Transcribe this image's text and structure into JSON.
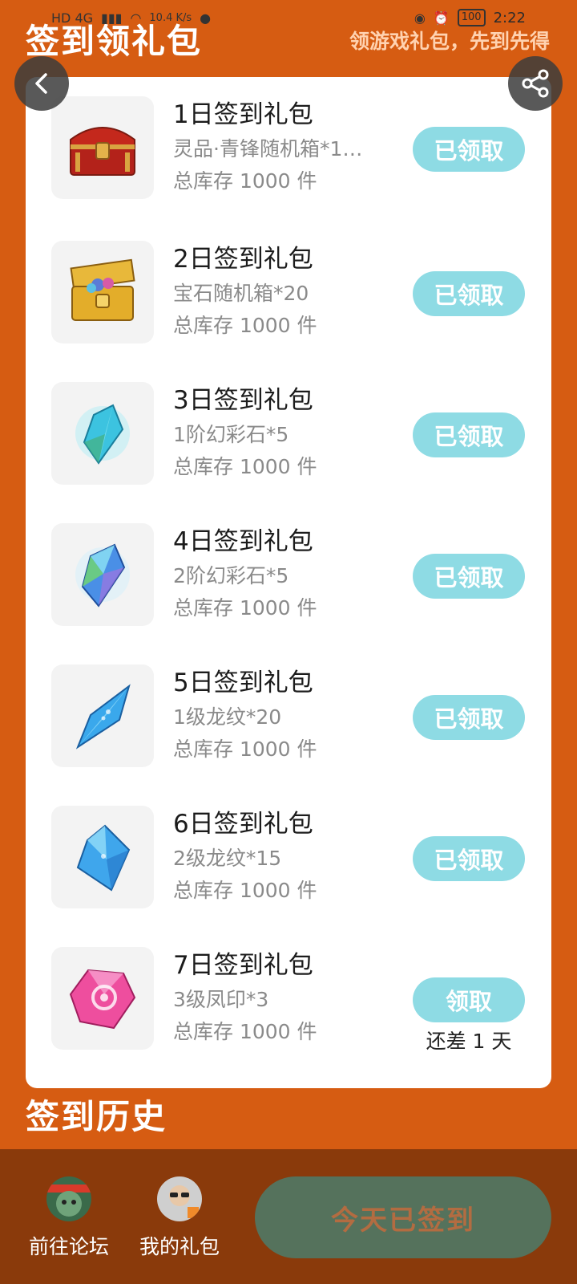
{
  "status_bar": {
    "left_text": "HD 4G",
    "time_small": "10.4 K/s",
    "battery": "100",
    "time": "2:22"
  },
  "header": {
    "title": "签到领礼包",
    "subtitle": "领游戏礼包，先到先得"
  },
  "gifts": [
    {
      "title": "1日签到礼包",
      "desc": "灵品·青锋随机箱*1…",
      "stock": "总库存 1000 件",
      "button": "已领取",
      "icon": "red-treasure-chest-icon"
    },
    {
      "title": "2日签到礼包",
      "desc": "宝石随机箱*20",
      "stock": "总库存 1000 件",
      "button": "已领取",
      "icon": "gold-treasure-chest-icon"
    },
    {
      "title": "3日签到礼包",
      "desc": "1阶幻彩石*5",
      "stock": "总库存 1000 件",
      "button": "已领取",
      "icon": "blue-crystal-icon"
    },
    {
      "title": "4日签到礼包",
      "desc": "2阶幻彩石*5",
      "stock": "总库存 1000 件",
      "button": "已领取",
      "icon": "rainbow-crystal-icon"
    },
    {
      "title": "5日签到礼包",
      "desc": "1级龙纹*20",
      "stock": "总库存 1000 件",
      "button": "已领取",
      "icon": "blue-shard-icon"
    },
    {
      "title": "6日签到礼包",
      "desc": "2级龙纹*15",
      "stock": "总库存 1000 件",
      "button": "已领取",
      "icon": "blue-gem-icon"
    },
    {
      "title": "7日签到礼包",
      "desc": "3级凤印*3",
      "stock": "总库存 1000 件",
      "button": "领取",
      "remain": "还差 1 天",
      "icon": "pink-gem-icon"
    }
  ],
  "history": {
    "title": "签到历史"
  },
  "bottom_bar": {
    "forum_label": "前往论坛",
    "gifts_label": "我的礼包",
    "checkin_label": "今天已签到"
  },
  "colors": {
    "background": "#D65C12",
    "button": "#8EDBE4",
    "bottom_bar": "#8A3A0B",
    "checkin_button": "#55725C"
  }
}
